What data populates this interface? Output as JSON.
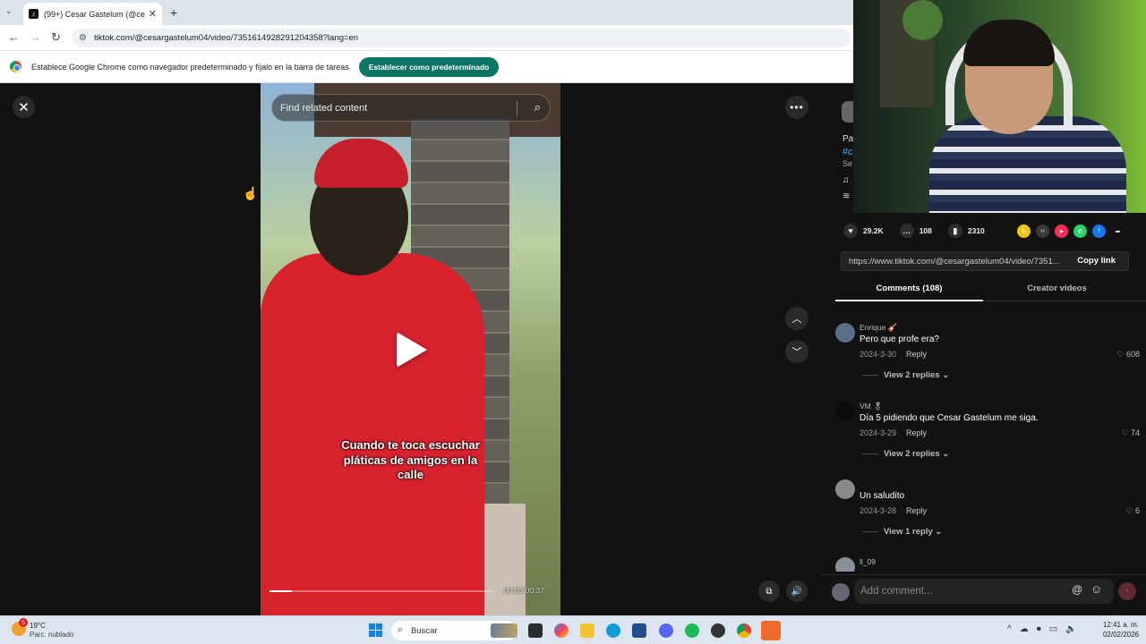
{
  "browser": {
    "tab_title": "(99+) Cesar Gastelum (@cesarg",
    "tab_close": "✕",
    "new_tab": "+",
    "url": "tiktok.com/@cesargastelum04/video/7351614928291204358?lang=en",
    "infobar_text": "Establece Google Chrome como navegador predeterminado y fíjalo en la barra de tareas",
    "infobar_button": "Establecer como predeterminado"
  },
  "video": {
    "search_placeholder": "Find related content",
    "caption": "Cuando te toca escuchar pláticas de amigos en la calle",
    "time": "00:03/00:37",
    "progress": 0.1
  },
  "panel": {
    "desc_line1": "Pa",
    "desc_line2": "#c",
    "desc_line3": "Se",
    "music_icon": "♫",
    "desc_line5": "≋",
    "likes": "29.2K",
    "comments": "108",
    "saves": "2310",
    "share_url": "https://www.tiktok.com/@cesargastelum04/video/7351...",
    "copy_link": "Copy link",
    "tab_comments": "Comments (108)",
    "tab_creator": "Creator videos",
    "share_colors": [
      "#f2c511",
      "#3a3a3a",
      "#fe2c55",
      "#25d366",
      "#1877f2",
      "#121212"
    ]
  },
  "comments": [
    {
      "user": "Enrique 🎸",
      "text": "Pero que profe era?",
      "date": "2024-3-30",
      "reply": "Reply",
      "likes": "608",
      "view": "View 2 replies"
    },
    {
      "user": "VM 🎖",
      "text": "Día 5 pidiendo que Cesar Gastelum me siga.",
      "date": "2024-3-29",
      "reply": "Reply",
      "likes": "74",
      "view": "View 2 replies"
    },
    {
      "user": "",
      "text": "Un saludito",
      "date": "2024-3-28",
      "reply": "Reply",
      "likes": "6",
      "view": "View 1 reply"
    },
    {
      "user": "ll_09",
      "text": "",
      "date": "",
      "reply": "",
      "likes": "",
      "view": ""
    }
  ],
  "add_comment_placeholder": "Add comment...",
  "taskbar": {
    "weather_badge": "5",
    "temp": "19°C",
    "condition": "Parc. nublado",
    "search": "Buscar",
    "time": "12:41 a. m.",
    "date": "02/02/2026"
  }
}
